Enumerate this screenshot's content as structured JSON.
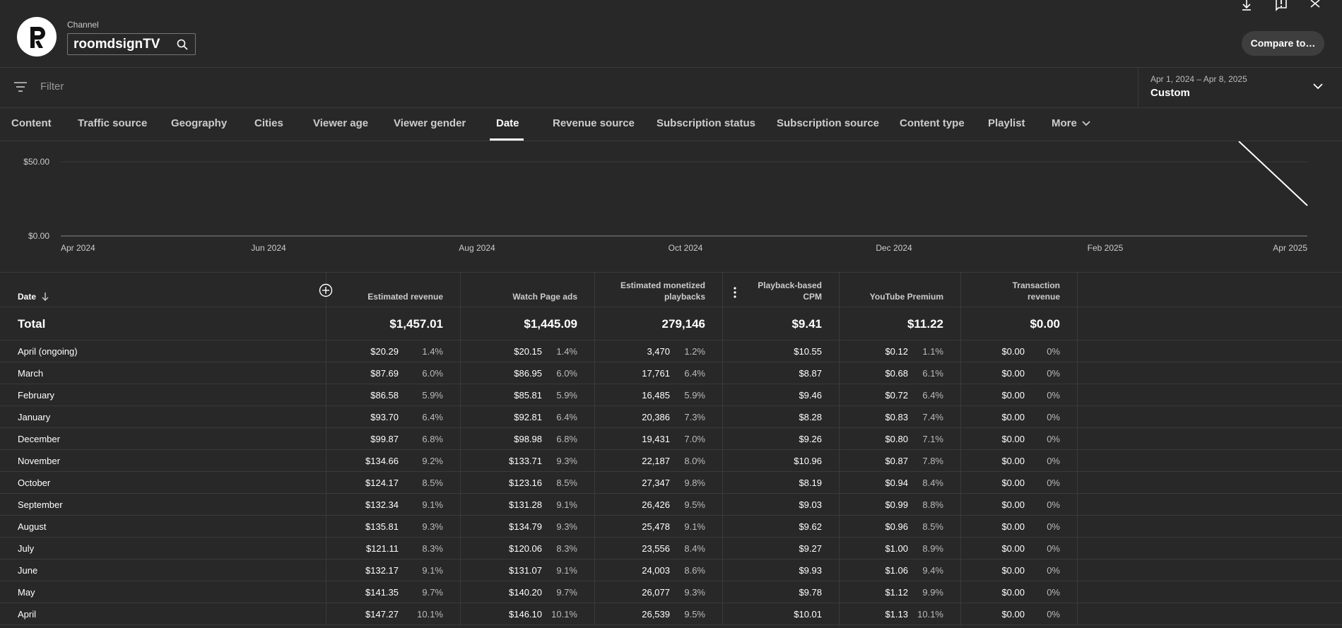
{
  "header": {
    "channel_label": "Channel",
    "channel_name": "roomdsignTV",
    "compare_label": "Compare to…"
  },
  "filter": {
    "placeholder": "Filter",
    "date_range": "Apr 1, 2024 – Apr 8, 2025",
    "date_preset": "Custom"
  },
  "tabs": [
    "Content",
    "Traffic source",
    "Geography",
    "Cities",
    "Viewer age",
    "Viewer gender",
    "Date",
    "Revenue source",
    "Subscription status",
    "Subscription source",
    "Content type",
    "Playlist",
    "More"
  ],
  "active_tab": "Date",
  "chart_data": {
    "type": "line",
    "y_ticks": [
      "$50.00",
      "$0.00"
    ],
    "x_ticks": [
      "Apr 2024",
      "Jun 2024",
      "Aug 2024",
      "Oct 2024",
      "Dec 2024",
      "Feb 2025",
      "Apr 2025"
    ],
    "series": [
      {
        "values": []
      }
    ]
  },
  "table": {
    "columns": [
      "Date",
      "Estimated revenue",
      "Watch Page ads",
      "Estimated monetized playbacks",
      "Playback-based CPM",
      "YouTube Premium",
      "Transaction revenue"
    ],
    "total": {
      "label": "Total",
      "values": [
        "$1,457.01",
        "$1,445.09",
        "279,146",
        "$9.41",
        "$11.22",
        "$0.00"
      ]
    },
    "rows": [
      {
        "label": "April (ongoing)",
        "rev": "$20.29",
        "rev_pct": "1.4%",
        "wpa": "$20.15",
        "wpa_pct": "1.4%",
        "mp": "3,470",
        "mp_pct": "1.2%",
        "cpm": "$10.55",
        "ytp": "$0.12",
        "ytp_pct": "1.1%",
        "tr": "$0.00",
        "tr_pct": "0%"
      },
      {
        "label": "March",
        "rev": "$87.69",
        "rev_pct": "6.0%",
        "wpa": "$86.95",
        "wpa_pct": "6.0%",
        "mp": "17,761",
        "mp_pct": "6.4%",
        "cpm": "$8.87",
        "ytp": "$0.68",
        "ytp_pct": "6.1%",
        "tr": "$0.00",
        "tr_pct": "0%"
      },
      {
        "label": "February",
        "rev": "$86.58",
        "rev_pct": "5.9%",
        "wpa": "$85.81",
        "wpa_pct": "5.9%",
        "mp": "16,485",
        "mp_pct": "5.9%",
        "cpm": "$9.46",
        "ytp": "$0.72",
        "ytp_pct": "6.4%",
        "tr": "$0.00",
        "tr_pct": "0%"
      },
      {
        "label": "January",
        "rev": "$93.70",
        "rev_pct": "6.4%",
        "wpa": "$92.81",
        "wpa_pct": "6.4%",
        "mp": "20,386",
        "mp_pct": "7.3%",
        "cpm": "$8.28",
        "ytp": "$0.83",
        "ytp_pct": "7.4%",
        "tr": "$0.00",
        "tr_pct": "0%"
      },
      {
        "label": "December",
        "rev": "$99.87",
        "rev_pct": "6.8%",
        "wpa": "$98.98",
        "wpa_pct": "6.8%",
        "mp": "19,431",
        "mp_pct": "7.0%",
        "cpm": "$9.26",
        "ytp": "$0.80",
        "ytp_pct": "7.1%",
        "tr": "$0.00",
        "tr_pct": "0%"
      },
      {
        "label": "November",
        "rev": "$134.66",
        "rev_pct": "9.2%",
        "wpa": "$133.71",
        "wpa_pct": "9.3%",
        "mp": "22,187",
        "mp_pct": "8.0%",
        "cpm": "$10.96",
        "ytp": "$0.87",
        "ytp_pct": "7.8%",
        "tr": "$0.00",
        "tr_pct": "0%"
      },
      {
        "label": "October",
        "rev": "$124.17",
        "rev_pct": "8.5%",
        "wpa": "$123.16",
        "wpa_pct": "8.5%",
        "mp": "27,347",
        "mp_pct": "9.8%",
        "cpm": "$8.19",
        "ytp": "$0.94",
        "ytp_pct": "8.4%",
        "tr": "$0.00",
        "tr_pct": "0%"
      },
      {
        "label": "September",
        "rev": "$132.34",
        "rev_pct": "9.1%",
        "wpa": "$131.28",
        "wpa_pct": "9.1%",
        "mp": "26,426",
        "mp_pct": "9.5%",
        "cpm": "$9.03",
        "ytp": "$0.99",
        "ytp_pct": "8.8%",
        "tr": "$0.00",
        "tr_pct": "0%"
      },
      {
        "label": "August",
        "rev": "$135.81",
        "rev_pct": "9.3%",
        "wpa": "$134.79",
        "wpa_pct": "9.3%",
        "mp": "25,478",
        "mp_pct": "9.1%",
        "cpm": "$9.62",
        "ytp": "$0.96",
        "ytp_pct": "8.5%",
        "tr": "$0.00",
        "tr_pct": "0%"
      },
      {
        "label": "July",
        "rev": "$121.11",
        "rev_pct": "8.3%",
        "wpa": "$120.06",
        "wpa_pct": "8.3%",
        "mp": "23,556",
        "mp_pct": "8.4%",
        "cpm": "$9.27",
        "ytp": "$1.00",
        "ytp_pct": "8.9%",
        "tr": "$0.00",
        "tr_pct": "0%"
      },
      {
        "label": "June",
        "rev": "$132.17",
        "rev_pct": "9.1%",
        "wpa": "$131.07",
        "wpa_pct": "9.1%",
        "mp": "24,003",
        "mp_pct": "8.6%",
        "cpm": "$9.93",
        "ytp": "$1.06",
        "ytp_pct": "9.4%",
        "tr": "$0.00",
        "tr_pct": "0%"
      },
      {
        "label": "May",
        "rev": "$141.35",
        "rev_pct": "9.7%",
        "wpa": "$140.20",
        "wpa_pct": "9.7%",
        "mp": "26,077",
        "mp_pct": "9.3%",
        "cpm": "$9.78",
        "ytp": "$1.12",
        "ytp_pct": "9.9%",
        "tr": "$0.00",
        "tr_pct": "0%"
      },
      {
        "label": "April",
        "rev": "$147.27",
        "rev_pct": "10.1%",
        "wpa": "$146.10",
        "wpa_pct": "10.1%",
        "mp": "26,539",
        "mp_pct": "9.5%",
        "cpm": "$10.01",
        "ytp": "$1.13",
        "ytp_pct": "10.1%",
        "tr": "$0.00",
        "tr_pct": "0%"
      }
    ]
  },
  "icons": {
    "download": "download-icon",
    "feedback": "feedback-icon",
    "close": "close-icon",
    "search": "search-icon",
    "filter": "filter-icon",
    "chevron": "chevron-down-icon",
    "add_column": "add-column-icon",
    "sort": "sort-arrow-icon",
    "column_menu": "more-vert-icon"
  }
}
